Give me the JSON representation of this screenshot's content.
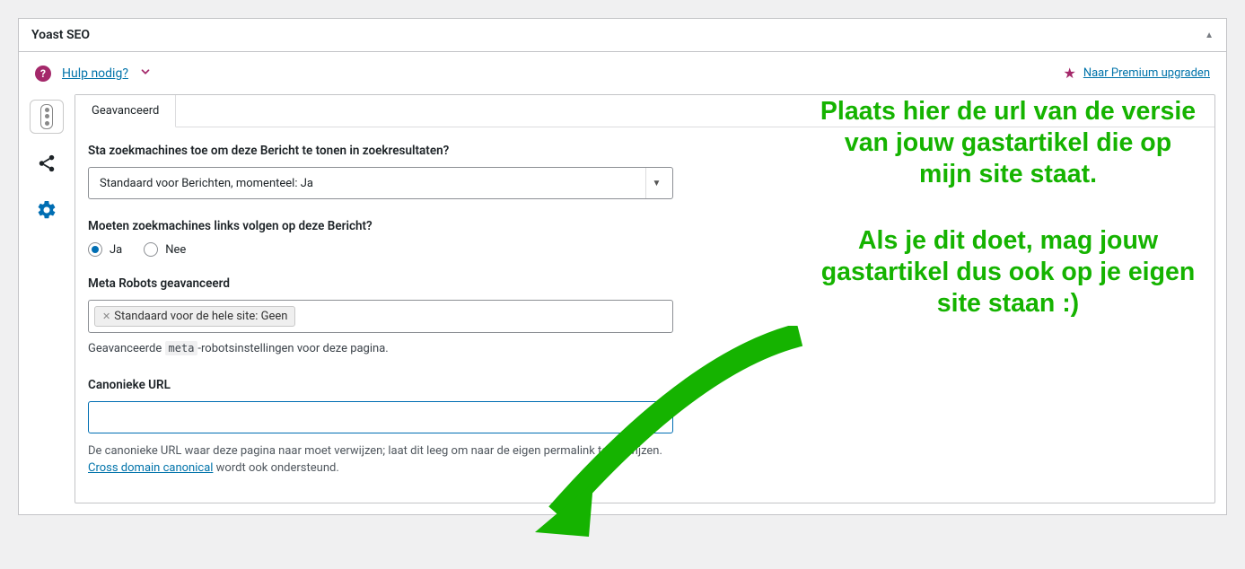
{
  "header": {
    "title": "Yoast SEO"
  },
  "helpbar": {
    "help_link": "Hulp nodig?",
    "premium_link": "Naar Premium upgraden"
  },
  "form_tab": {
    "label": "Geavanceerd"
  },
  "fields": {
    "index": {
      "label": "Sta zoekmachines toe om deze Bericht te tonen in zoekresultaten?",
      "selected": "Standaard voor Berichten, momenteel: Ja"
    },
    "follow": {
      "label": "Moeten zoekmachines links volgen op deze Bericht?",
      "options": {
        "yes": "Ja",
        "no": "Nee"
      },
      "selected": "yes"
    },
    "meta_robots": {
      "label": "Meta Robots geavanceerd",
      "chip": "Standaard voor de hele site: Geen",
      "help_pre": "Geavanceerde ",
      "help_code": "meta",
      "help_post": "-robotsinstellingen voor deze pagina."
    },
    "canonical": {
      "label": "Canonieke URL",
      "value": "",
      "desc_pre": "De canonieke URL waar deze pagina naar moet verwijzen; laat dit leeg om naar de eigen permalink te verwijzen. ",
      "desc_link": "Cross domain canonical",
      "desc_post": " wordt ook ondersteund."
    }
  },
  "annotation": {
    "p1": "Plaats hier de url van de versie van jouw gastartikel die op mijn site staat.",
    "p2": "Als je dit doet, mag jouw gastartikel dus ook op je eigen site staan :)"
  },
  "icons": {
    "traffic": "traffic-light-icon",
    "share": "share-icon",
    "gear": "gear-icon",
    "star": "star-icon",
    "help": "help-icon"
  }
}
